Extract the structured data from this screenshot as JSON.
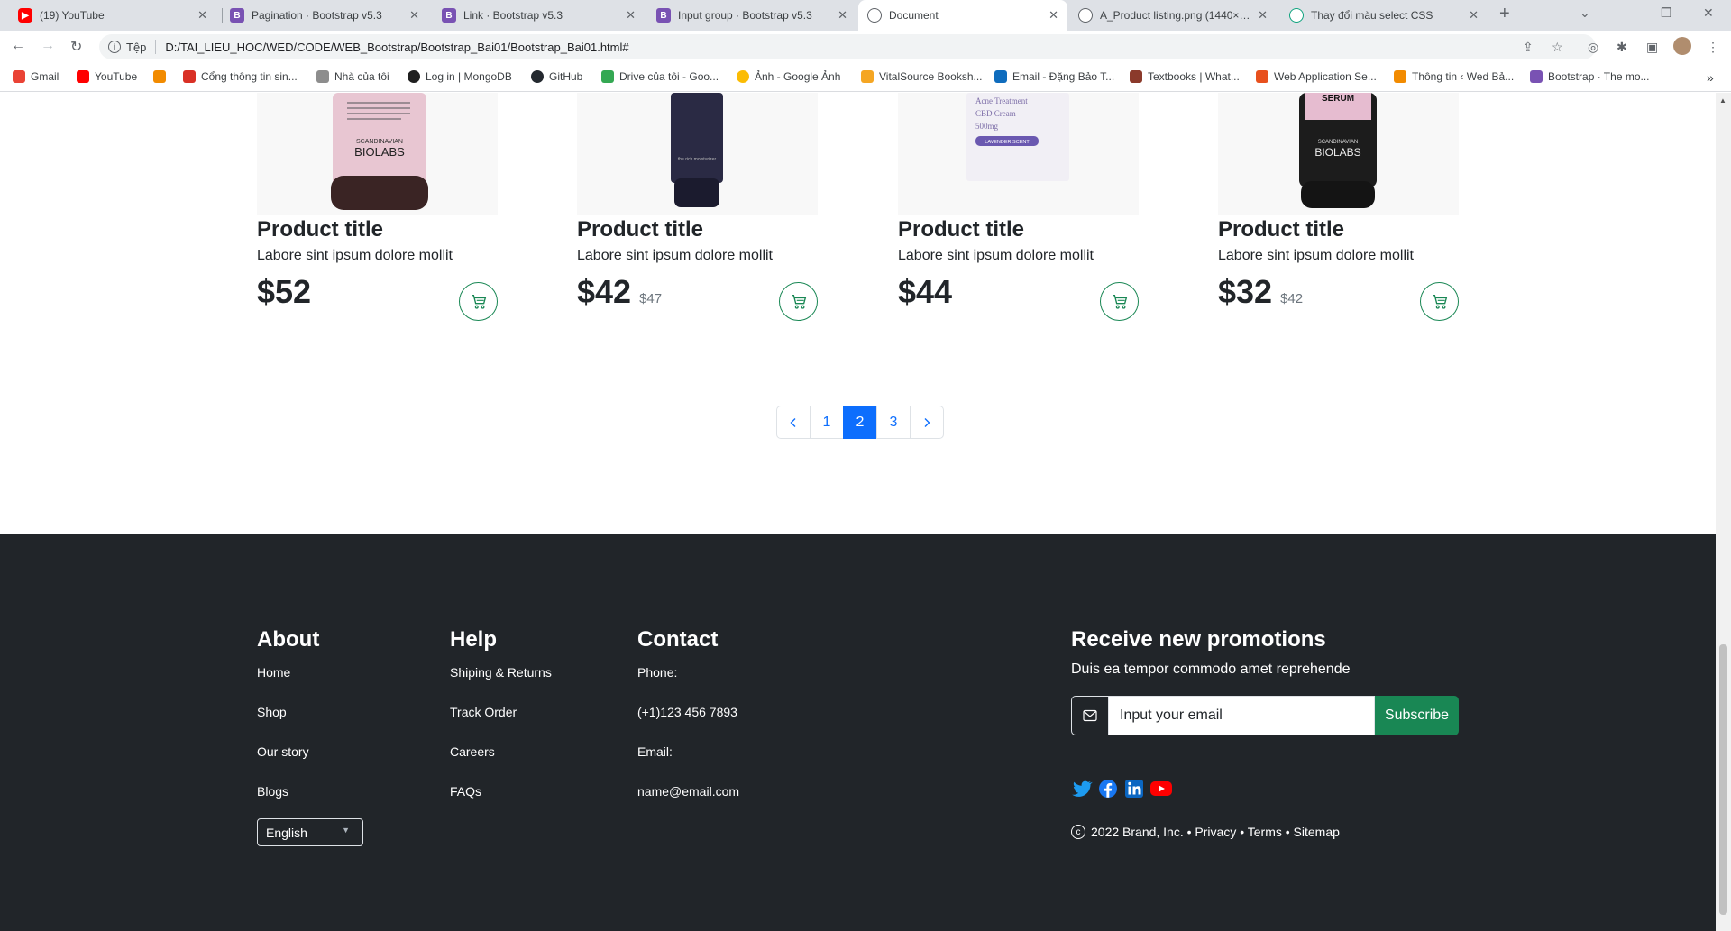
{
  "browser": {
    "tabs": [
      {
        "title": "(19) YouTube",
        "icon": "youtube-icon"
      },
      {
        "title": "Pagination · Bootstrap v5.3",
        "icon": "bootstrap-icon"
      },
      {
        "title": "Link · Bootstrap v5.3",
        "icon": "bootstrap-icon"
      },
      {
        "title": "Input group · Bootstrap v5.3",
        "icon": "bootstrap-icon"
      },
      {
        "title": "Document",
        "icon": "globe-icon",
        "active": true
      },
      {
        "title": "A_Product listing.png (1440×28…",
        "icon": "globe-icon"
      },
      {
        "title": "Thay đổi màu select CSS",
        "icon": "chatgpt-icon"
      }
    ],
    "address": {
      "scheme": "Tệp",
      "url": "D:/TAI_LIEU_HOC/WED/CODE/WEB_Bootstrap/Bootstrap_Bai01/Bootstrap_Bai01.html#"
    },
    "bookmarks": [
      "Gmail",
      "YouTube",
      "",
      "Cổng thông tin sin...",
      "Nhà của tôi",
      "Log in | MongoDB",
      "GitHub",
      "Drive của tôi - Goo...",
      "Ảnh - Google Ảnh",
      "VitalSource Booksh...",
      "Email - Đặng Bảo T...",
      "Textbooks | What...",
      "Web Application Se...",
      "Thông tin ‹ Wed Bả...",
      "Bootstrap · The mo..."
    ]
  },
  "products": [
    {
      "title": "Product title",
      "desc": "Labore sint ipsum dolore mollit",
      "price": "$52",
      "old": ""
    },
    {
      "title": "Product title",
      "desc": "Labore sint ipsum dolore mollit",
      "price": "$42",
      "old": "$47"
    },
    {
      "title": "Product title",
      "desc": "Labore sint ipsum dolore mollit",
      "price": "$44",
      "old": ""
    },
    {
      "title": "Product title",
      "desc": "Labore sint ipsum dolore mollit",
      "price": "$32",
      "old": "$42"
    }
  ],
  "product_images": {
    "label_1": "SCANDINAVIAN",
    "label_2": "BIOLABS",
    "label_3": "the rich moisturizer",
    "label_4": "Acne Treatment",
    "label_5": "CBD Cream",
    "label_6": "500mg",
    "label_7": "LAVENDER SCENT",
    "label_8": "SERUM"
  },
  "pagination": {
    "pages": [
      "1",
      "2",
      "3"
    ],
    "active": "2"
  },
  "footer": {
    "about": {
      "heading": "About",
      "links": [
        "Home",
        "Shop",
        "Our story",
        "Blogs"
      ]
    },
    "help": {
      "heading": "Help",
      "links": [
        "Shiping & Returns",
        "Track Order",
        "Careers",
        "FAQs"
      ]
    },
    "contact": {
      "heading": "Contact",
      "lines": [
        "Phone:",
        "(+1)123 456 7893",
        "Email:",
        "name@email.com"
      ]
    },
    "language": "English",
    "promo": {
      "heading": "Receive new promotions",
      "sub": "Duis ea tempor commodo amet reprehende",
      "placeholder": "Input your email",
      "button": "Subscribe"
    },
    "copyright": {
      "symbol": "c",
      "text": "2022 Brand, Inc. • Privacy • Terms • Sitemap"
    }
  },
  "colors": {
    "primary": "#0d6efd",
    "success": "#198754",
    "dark": "#212529"
  }
}
